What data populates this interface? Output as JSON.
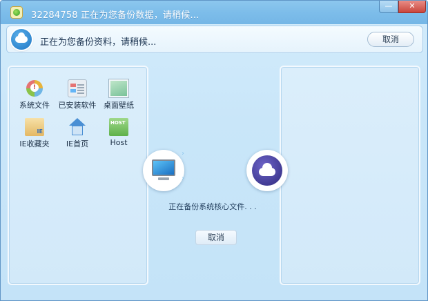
{
  "window": {
    "title": "32284758 正在为您备份数据，请稍候...",
    "minimize_label": "—",
    "close_label": "✕"
  },
  "status": {
    "message": "正在为您备份资料，请稍候...",
    "cancel_label": "取消"
  },
  "left_panel": {
    "items": [
      {
        "label": "系统文件",
        "icon": "system-files-icon"
      },
      {
        "label": "已安装软件",
        "icon": "installed-software-icon"
      },
      {
        "label": "桌面壁纸",
        "icon": "wallpaper-icon"
      },
      {
        "label": "IE收藏夹",
        "icon": "ie-favorites-icon"
      },
      {
        "label": "IE首页",
        "icon": "ie-homepage-icon"
      },
      {
        "label": "Host",
        "icon": "host-file-icon"
      }
    ]
  },
  "center": {
    "arrow_glyph": "›",
    "progress_text": "正在备份系统核心文件. . .",
    "cancel_label": "取消"
  },
  "colors": {
    "titlebar": "#7dbdea",
    "window_bg": "#c9e6f9",
    "close_button": "#c9463c",
    "cloud_badge": "#1f76c4",
    "cloud_target": "#2f2a7e"
  }
}
